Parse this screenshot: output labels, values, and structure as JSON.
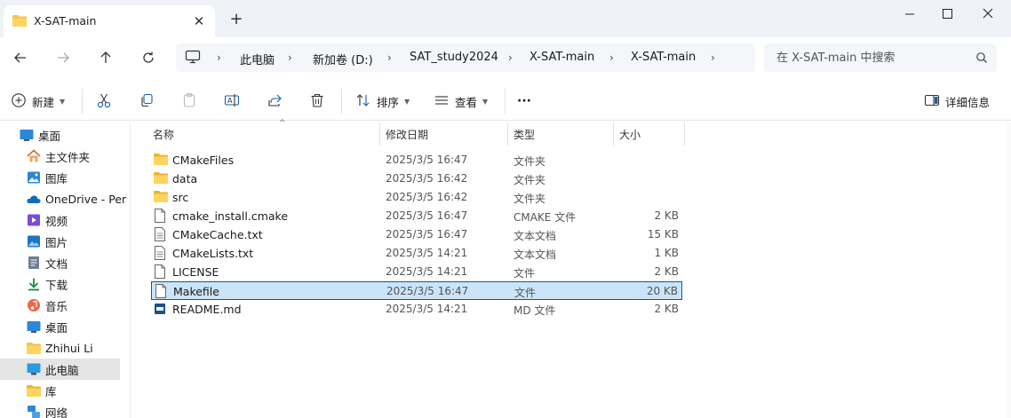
{
  "window": {
    "tab_title": "X-SAT-main",
    "tab_close": "✕",
    "new_tab": "+"
  },
  "address": {
    "breadcrumb": [
      "此电脑",
      "新加卷 (D:)",
      "SAT_study2024",
      "X-SAT-main",
      "X-SAT-main"
    ],
    "separator": "›",
    "search_placeholder": "在 X-SAT-main 中搜索"
  },
  "toolbar": {
    "new_label": "新建",
    "sort_label": "排序",
    "view_label": "查看",
    "more_label": "···",
    "details_label": "详细信息"
  },
  "nav": {
    "items": [
      {
        "label": "桌面",
        "icon": "desktop-icon"
      },
      {
        "label": "主文件夹",
        "icon": "home-icon"
      },
      {
        "label": "图库",
        "icon": "gallery-icon"
      },
      {
        "label": "OneDrive - Per",
        "icon": "onedrive-icon"
      },
      {
        "label": "视频",
        "icon": "videos-icon"
      },
      {
        "label": "图片",
        "icon": "pictures-icon"
      },
      {
        "label": "文档",
        "icon": "documents-icon"
      },
      {
        "label": "下载",
        "icon": "downloads-icon"
      },
      {
        "label": "音乐",
        "icon": "music-icon"
      },
      {
        "label": "桌面",
        "icon": "desktop-icon"
      },
      {
        "label": "Zhihui Li",
        "icon": "folder-icon"
      },
      {
        "label": "此电脑",
        "icon": "this-pc-icon",
        "selected": true
      },
      {
        "label": "库",
        "icon": "libraries-icon"
      },
      {
        "label": "网络",
        "icon": "network-icon"
      }
    ]
  },
  "columns": {
    "name": "名称",
    "modified": "修改日期",
    "type": "类型",
    "size": "大小",
    "sort_caret": "^"
  },
  "files": [
    {
      "name": "CMakeFiles",
      "date": "2025/3/5 16:47",
      "type": "文件夹",
      "size": "",
      "icon": "folder-icon"
    },
    {
      "name": "data",
      "date": "2025/3/5 16:42",
      "type": "文件夹",
      "size": "",
      "icon": "folder-icon"
    },
    {
      "name": "src",
      "date": "2025/3/5 16:42",
      "type": "文件夹",
      "size": "",
      "icon": "folder-icon"
    },
    {
      "name": "cmake_install.cmake",
      "date": "2025/3/5 16:47",
      "type": "CMAKE 文件",
      "size": "2 KB",
      "icon": "file-icon"
    },
    {
      "name": "CMakeCache.txt",
      "date": "2025/3/5 16:47",
      "type": "文本文档",
      "size": "15 KB",
      "icon": "text-file-icon"
    },
    {
      "name": "CMakeLists.txt",
      "date": "2025/3/5 14:21",
      "type": "文本文档",
      "size": "1 KB",
      "icon": "text-file-icon"
    },
    {
      "name": "LICENSE",
      "date": "2025/3/5 14:21",
      "type": "文件",
      "size": "2 KB",
      "icon": "file-icon"
    },
    {
      "name": "Makefile",
      "date": "2025/3/5 16:47",
      "type": "文件",
      "size": "20 KB",
      "icon": "file-icon",
      "selected": true
    },
    {
      "name": "README.md",
      "date": "2025/3/5 14:21",
      "type": "MD 文件",
      "size": "2 KB",
      "icon": "markdown-file-icon"
    }
  ],
  "colors": {
    "selection": "#cce4f7",
    "selection_border": "#0f5a9c",
    "folder": "#f5c542",
    "accent": "#0067c0"
  }
}
